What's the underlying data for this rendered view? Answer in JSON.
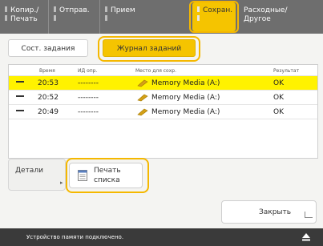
{
  "top_tabs": [
    {
      "line1": "Копир./",
      "line2": "Печать"
    },
    {
      "line1": "Отправ.",
      "line2": ""
    },
    {
      "line1": "Прием",
      "line2": ""
    },
    {
      "line1": "Сохран.",
      "line2": ""
    },
    {
      "line1": "Расходные/",
      "line2": "Другое"
    }
  ],
  "sub_tabs": {
    "status": "Сост. задания",
    "log": "Журнал заданий"
  },
  "table": {
    "headers": {
      "time": "Время",
      "id": "ИД опр.",
      "location": "Место для сохр.",
      "result": "Результат"
    },
    "rows": [
      {
        "time": "20:53",
        "id": "--------",
        "location": "Memory Media (A:)",
        "result": "OK"
      },
      {
        "time": "20:52",
        "id": "--------",
        "location": "Memory Media (A:)",
        "result": "OK"
      },
      {
        "time": "20:49",
        "id": "--------",
        "location": "Memory Media (A:)",
        "result": "OK"
      }
    ]
  },
  "buttons": {
    "details": "Детали",
    "print_list_1": "Печать",
    "print_list_2": "списка",
    "close": "Закрыть"
  },
  "status_bar": {
    "message": "Устройство памяти подключено."
  },
  "colors": {
    "accent": "#f5c400",
    "highlight_row": "#fff200",
    "topbar": "#6e6e6e",
    "statusbar": "#3a3a3a"
  }
}
